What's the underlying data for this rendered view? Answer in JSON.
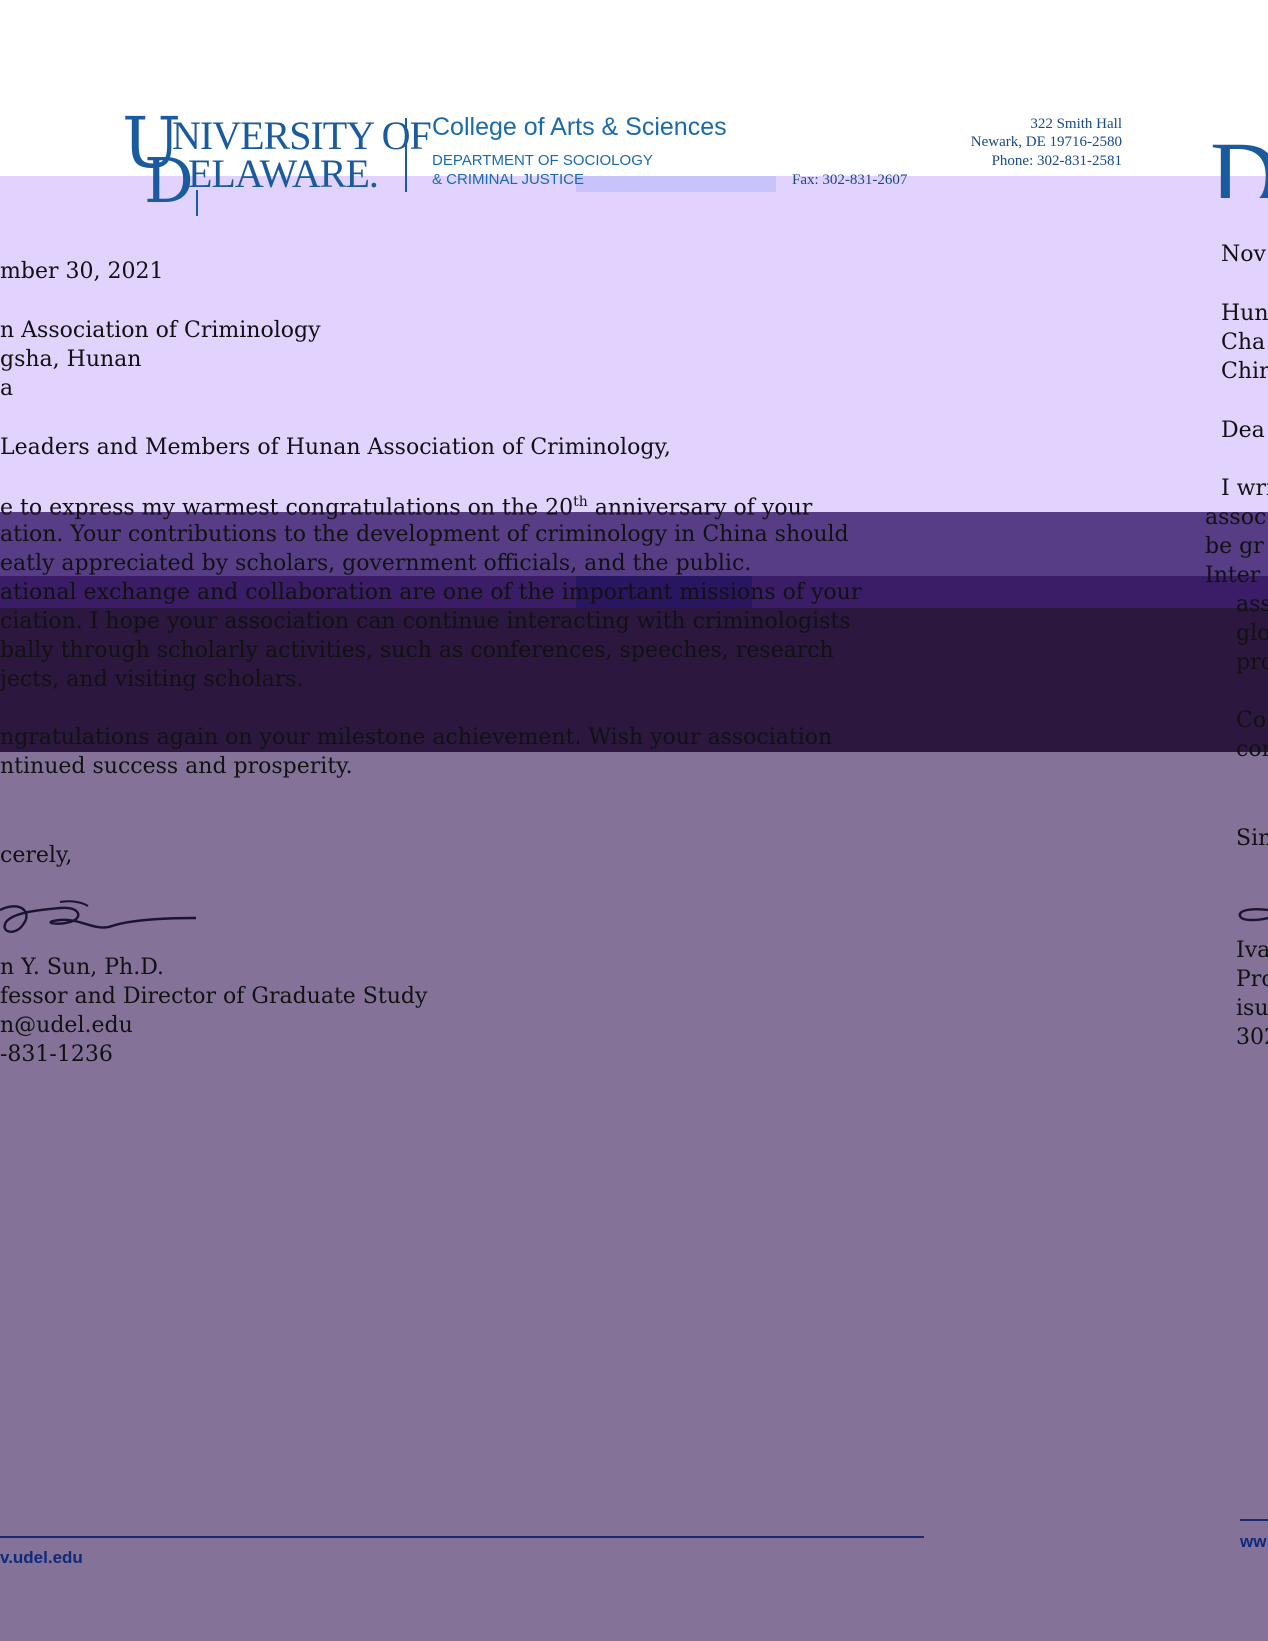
{
  "letterhead": {
    "logo_u": "U",
    "logo_d": "D",
    "logo_line1": "NIVERSITY OF",
    "logo_line2": "ELAWARE.",
    "college": "College of Arts & Sciences",
    "dept_line1": "DEPARTMENT OF SOCIOLOGY",
    "dept_line2": "& CRIMINAL JUSTICE",
    "address_line1": "322 Smith Hall",
    "address_line2": "Newark, DE 19716-2580",
    "phone": "Phone: 302-831-2581",
    "fax": "Fax: 302-831-2607",
    "big_d_fragment": "D"
  },
  "letter": {
    "date": "mber 30, 2021",
    "recipient_line1": "n Association of Criminology",
    "recipient_line2": "gsha, Hunan",
    "recipient_line3": "a",
    "salutation": " Leaders and Members of Hunan Association of Criminology,",
    "p1_line1": "e to express my warmest congratulations on the 20th anniversary of your",
    "p1_line2": "ation.  Your contributions to the development of criminology in China should",
    "p1_line3": "eatly appreciated by scholars, government officials, and the public.",
    "p1_line4": "ational exchange and collaboration are one of the important missions of your",
    "p1_line5": "ciation.  I hope your association can continue interacting with criminologists",
    "p1_line6": "bally through scholarly activities, such as conferences, speeches, research",
    "p1_line7": "jects, and visiting scholars.",
    "p2_line1": "ngratulations again on your milestone achievement.  Wish your association",
    "p2_line2": "ntinued success and prosperity.",
    "closing": "cerely,",
    "sig_name": "n Y. Sun, Ph.D.",
    "sig_title": "fessor and Director of Graduate Study",
    "sig_email": "n@udel.edu",
    "sig_phone": "-831-1236"
  },
  "right_column": {
    "date": "Nov",
    "r1": "Hun",
    "r2": "Cha",
    "r3": "Chir",
    "salutation": "Dea",
    "p1": "I wri",
    "p2": "assoc",
    "p3": "be gr",
    "p4": "Inter",
    "p5": "asso",
    "p6": "glo",
    "p7": "pro",
    "p8": "Co",
    "p9": "cor",
    "closing": "Sin",
    "name": "Iva",
    "title": "Pro",
    "email": "isu",
    "phone": "302"
  },
  "footer": {
    "url": "v.udel.edu",
    "url_right": "ww"
  }
}
